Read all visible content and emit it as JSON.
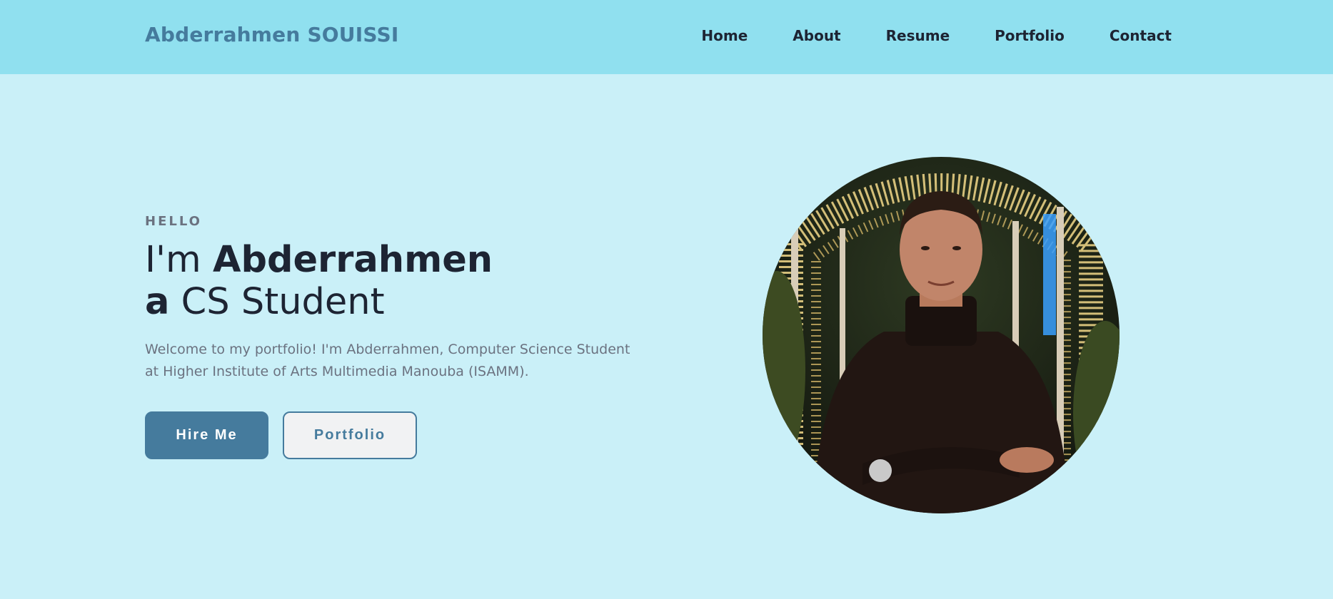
{
  "header": {
    "brand": "Abderrahmen SOUISSI",
    "nav": [
      "Home",
      "About",
      "Resume",
      "Portfolio",
      "Contact"
    ]
  },
  "hero": {
    "greeting": "HELLO",
    "line1_prefix": "I'm",
    "line1_name": "Abderrahmen",
    "line2_prefix": "a",
    "line2_rest": "CS Student",
    "intro": "Welcome to my portfolio! I'm Abderrahmen, Computer Science Student at Higher Institute of Arts Multimedia Manouba (ISAMM).",
    "buttons": {
      "primary": "Hire Me",
      "secondary": "Portfolio"
    }
  },
  "photo": {
    "subject": "portrait-photo"
  },
  "colors": {
    "navbar_bg": "#90e0ef",
    "page_bg": "#caf0f8",
    "accent": "#457b9d",
    "text_dark": "#1d2433",
    "text_muted": "#6b7280"
  }
}
